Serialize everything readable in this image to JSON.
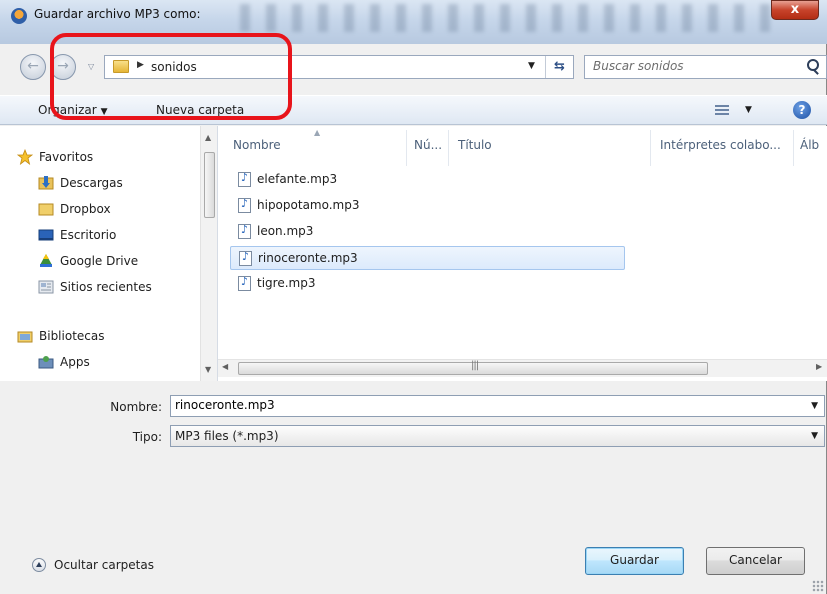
{
  "window": {
    "title": "Guardar archivo MP3 como:",
    "close_label": "x"
  },
  "address": {
    "back_label": "←",
    "forward_label": "→",
    "crumb": "sonidos",
    "refresh_label": "⇆",
    "search_placeholder": "Buscar sonidos"
  },
  "toolbar": {
    "organize_label": "Organizar",
    "organize_caret": "▼",
    "new_folder_label": "Nueva carpeta",
    "view_caret": "▼",
    "help_label": "?"
  },
  "sidebar": {
    "items": [
      {
        "label": "Favoritos",
        "icon": "star-icon",
        "level": 0
      },
      {
        "label": "Descargas",
        "icon": "downloads-folder-icon",
        "level": 1
      },
      {
        "label": "Dropbox",
        "icon": "folder-icon",
        "level": 1
      },
      {
        "label": "Escritorio",
        "icon": "desktop-icon",
        "level": 1
      },
      {
        "label": "Google Drive",
        "icon": "google-drive-icon",
        "level": 1
      },
      {
        "label": "Sitios recientes",
        "icon": "recent-places-icon",
        "level": 1
      },
      {
        "label": "Bibliotecas",
        "icon": "libraries-icon",
        "level": 0
      },
      {
        "label": "Apps",
        "icon": "apps-icon",
        "level": 1
      }
    ]
  },
  "columns": {
    "name": "Nombre",
    "number": "Nú...",
    "title": "Título",
    "artists": "Intérpretes colabo...",
    "album": "Álb"
  },
  "files": [
    {
      "name": "elefante.mp3",
      "selected": false
    },
    {
      "name": "hipopotamo.mp3",
      "selected": false
    },
    {
      "name": "leon.mp3",
      "selected": false
    },
    {
      "name": "rinoceronte.mp3",
      "selected": true
    },
    {
      "name": "tigre.mp3",
      "selected": false
    }
  ],
  "form": {
    "filename_label": "Nombre:",
    "filename_value": "rinoceronte.mp3",
    "type_label": "Tipo:",
    "type_value": "MP3 files (*.mp3)"
  },
  "footer": {
    "hide_folders_label": "Ocultar carpetas",
    "save_label": "Guardar",
    "cancel_label": "Cancelar"
  },
  "colors": {
    "highlight": "#e8141b",
    "selection": "#dceafc",
    "accent": "#3c7fb1"
  }
}
